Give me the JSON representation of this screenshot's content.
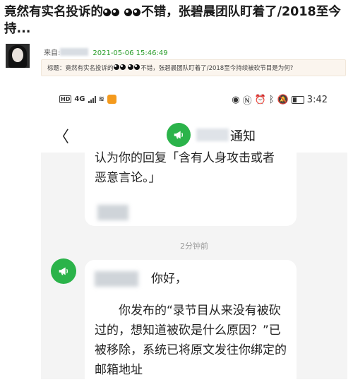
{
  "post": {
    "title_a": "竟然有实名投诉的",
    "title_b": "不错，张碧晨团队盯着了/2018至今持...",
    "source_label": "来自:",
    "date": "2021-05-06 15:46:49",
    "notice_a": "标题：竟然有实名投诉的",
    "notice_b": "不错，张碧晨团队盯着了/2018至今持续被砍节目是为何?"
  },
  "phone": {
    "status": {
      "network": "4G",
      "time": "3:42"
    },
    "nav": {
      "back_glyph": "〈",
      "title": "通知"
    },
    "messages": {
      "first_text": "认为你的回复「含有人身攻击或者恶意言论。」",
      "timestamp": "2分钟前",
      "greeting": "你好，",
      "body": "你发布的“录节目从来没有被砍过的，想知道被砍是什么原因？”已被移除，系统已将原文发往你绑定的邮箱地址"
    }
  },
  "colors": {
    "accent_green": "#2bb34a",
    "date_green": "#2a9d2a",
    "notice_bg": "#fbf5ee"
  }
}
